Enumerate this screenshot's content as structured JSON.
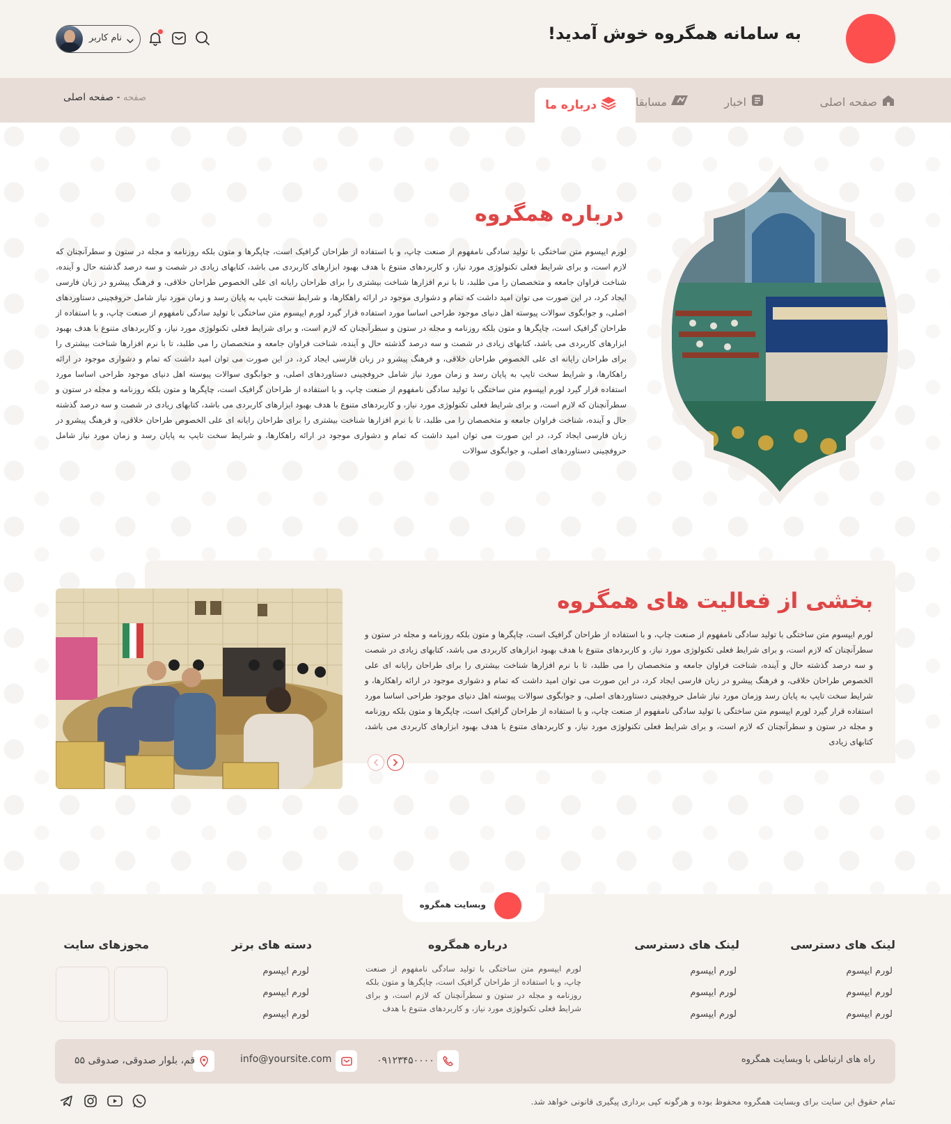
{
  "header": {
    "welcome": "به سامانه همگروه خوش آمدید!",
    "user_name": "نام کاربر",
    "brand_color": "#fe4f4f"
  },
  "nav": {
    "items": [
      {
        "label": "صفحه اصلی",
        "icon": "home-icon"
      },
      {
        "label": "اخبار",
        "icon": "news-icon"
      },
      {
        "label": "مسابقات",
        "icon": "competition-icon"
      },
      {
        "label": "درباره ما",
        "icon": "layers-icon",
        "active": true
      }
    ],
    "breadcrumb": {
      "root": "صفحه",
      "separator": "-",
      "current": "صفحه اصلی"
    }
  },
  "about": {
    "title": "درباره همگروه",
    "body": "لورم ایپسوم متن ساختگی با تولید سادگی نامفهوم از صنعت چاپ، و با استفاده از طراحان گرافیک است، چاپگرها و متون بلکه روزنامه و مجله در ستون و سطرآنچنان که لازم است، و برای شرایط فعلی تکنولوژی مورد نیاز، و کاربردهای متنوع با هدف بهبود ابزارهای کاربردی می باشد، کتابهای زیادی در شصت و سه درصد گذشته حال و آینده، شناخت فراوان جامعه و متخصصان را می طلبد، تا با نرم افزارها شناخت بیشتری را برای طراحان رایانه ای علی الخصوص طراحان خلاقی، و فرهنگ پیشرو در زبان فارسی ایجاد کرد، در این صورت می توان امید داشت که تمام و دشواری موجود در ارائه راهکارها، و شرایط سخت تایپ به پایان رسد و زمان مورد نیاز شامل حروفچینی دستاوردهای اصلی، و جوابگوی سوالات پیوسته اهل دنیای موجود طراحی اساسا مورد استفاده قرار گیرد لورم ایپسوم متن ساختگی با تولید سادگی نامفهوم از صنعت چاپ، و با استفاده از طراحان گرافیک است، چاپگرها و متون بلکه روزنامه و مجله در ستون و سطرآنچنان که لازم است، و برای شرایط فعلی تکنولوژی مورد نیاز، و کاربردهای متنوع با هدف بهبود ابزارهای کاربردی می باشد، کتابهای زیادی در شصت و سه درصد گذشته حال و آینده، شناخت فراوان جامعه و متخصصان را می طلبد، تا با نرم افزارها شناخت بیشتری را برای طراحان رایانه ای علی الخصوص طراحان خلاقی، و فرهنگ پیشرو در زبان فارسی ایجاد کرد، در این صورت می توان امید داشت که تمام و دشواری موجود در ارائه راهکارها، و شرایط سخت تایپ به پایان رسد و زمان مورد نیاز شامل حروفچینی دستاوردهای اصلی، و جوابگوی سوالات پیوسته اهل دنیای موجود طراحی اساسا مورد استفاده قرار گیرد لورم ایپسوم متن ساختگی با تولید سادگی نامفهوم از صنعت چاپ، و با استفاده از طراحان گرافیک است، چاپگرها و متون بلکه روزنامه و مجله در ستون و سطرآنچنان که لازم است، و برای شرایط فعلی تکنولوژی مورد نیاز، و کاربردهای متنوع با هدف بهبود ابزارهای کاربردی می باشد، کتابهای زیادی در شصت و سه درصد گذشته حال و آینده، شناخت فراوان جامعه و متخصصان را می طلبد، تا با نرم افزارها شناخت بیشتری را برای طراحان رایانه ای علی الخصوص طراحان خلاقی، و فرهنگ پیشرو در زبان فارسی ایجاد کرد، در این صورت می توان امید داشت که تمام و دشواری موجود در ارائه راهکارها، و شرایط سخت تایپ به پایان رسد و زمان مورد نیاز شامل حروفچینی دستاوردهای اصلی، و جوابگوی سوالات"
  },
  "activities": {
    "title": "بخشی از فعالیت های همگروه",
    "body": "لورم ایپسوم متن ساختگی با تولید سادگی نامفهوم از صنعت چاپ، و با استفاده از طراحان گرافیک است، چاپگرها و متون بلکه روزنامه و مجله در ستون و سطرآنچنان که لازم است، و برای شرایط فعلی تکنولوژی مورد نیاز، و کاربردهای متنوع با هدف بهبود ابزارهای کاربردی می باشد، کتابهای زیادی در شصت و سه درصد گذشته حال و آینده، شناخت فراوان جامعه و متخصصان را می طلبد، تا با نرم افزارها شناخت بیشتری را برای طراحان رایانه ای علی الخصوص طراحان خلاقی، و فرهنگ پیشرو در زبان فارسی ایجاد کرد، در این صورت می توان امید داشت که تمام و دشواری موجود در ارائه راهکارها، و شرایط سخت تایپ به پایان رسد وزمان مورد نیاز شامل حروفچینی دستاوردهای اصلی، و جوابگوی سوالات پیوسته اهل دنیای موجود طراحی اساسا مورد استفاده قرار گیرد لورم ایپسوم متن ساختگی با تولید سادگی نامفهوم از صنعت چاپ، و با استفاده از طراحان گرافیک است، چاپگرها و متون بلکه روزنامه و مجله در ستون و سطرآنچنان که لازم است، و برای شرایط فعلی تکنولوژی مورد نیاز، و کاربردهای متنوع با هدف بهبود ابزارهای کاربردی می باشد، کتابهای زیادی"
  },
  "footer": {
    "brand": "وبسایت همگروه",
    "columns": [
      {
        "title": "لینک های دسترسی",
        "links": [
          "لورم ایپسوم",
          "لورم ایپسوم",
          "لورم ایپسوم"
        ]
      },
      {
        "title": "لینک های دسترسی",
        "links": [
          "لورم ایپسوم",
          "لورم ایپسوم",
          "لورم ایپسوم"
        ]
      },
      {
        "title": "درباره همگروه",
        "text": "لورم ایپسوم متن ساختگی با تولید سادگی نامفهوم از صنعت چاپ، و با استفاده از طراحان گرافیک است، چاپگرها و متون بلکه روزنامه و مجله در ستون و سطرآنچنان که لازم است، و برای شرایط فعلی تکنولوژی مورد نیاز، و کاربردهای متنوع با هدف"
      },
      {
        "title": "دسته های برتر",
        "links": [
          "لورم ایپسوم",
          "لورم ایپسوم",
          "لورم ایپسوم"
        ]
      },
      {
        "title": "مجوزهای سایت"
      }
    ],
    "contact": {
      "label": "راه های ارتباطی با وبسایت همگروه",
      "phone": "۰۹۱۲۳۴۵۰۰۰۰",
      "email": "info@yoursite.com",
      "address": "قم، بلوار صدوقی، صدوقی ۵۵"
    },
    "copyright": "تمام حقوق این سایت برای وبسایت همگروه محفوظ بوده و هرگونه کپی برداری پیگیری قانونی خواهد شد.",
    "social": [
      "whatsapp-icon",
      "youtube-icon",
      "instagram-icon",
      "telegram-icon"
    ]
  }
}
